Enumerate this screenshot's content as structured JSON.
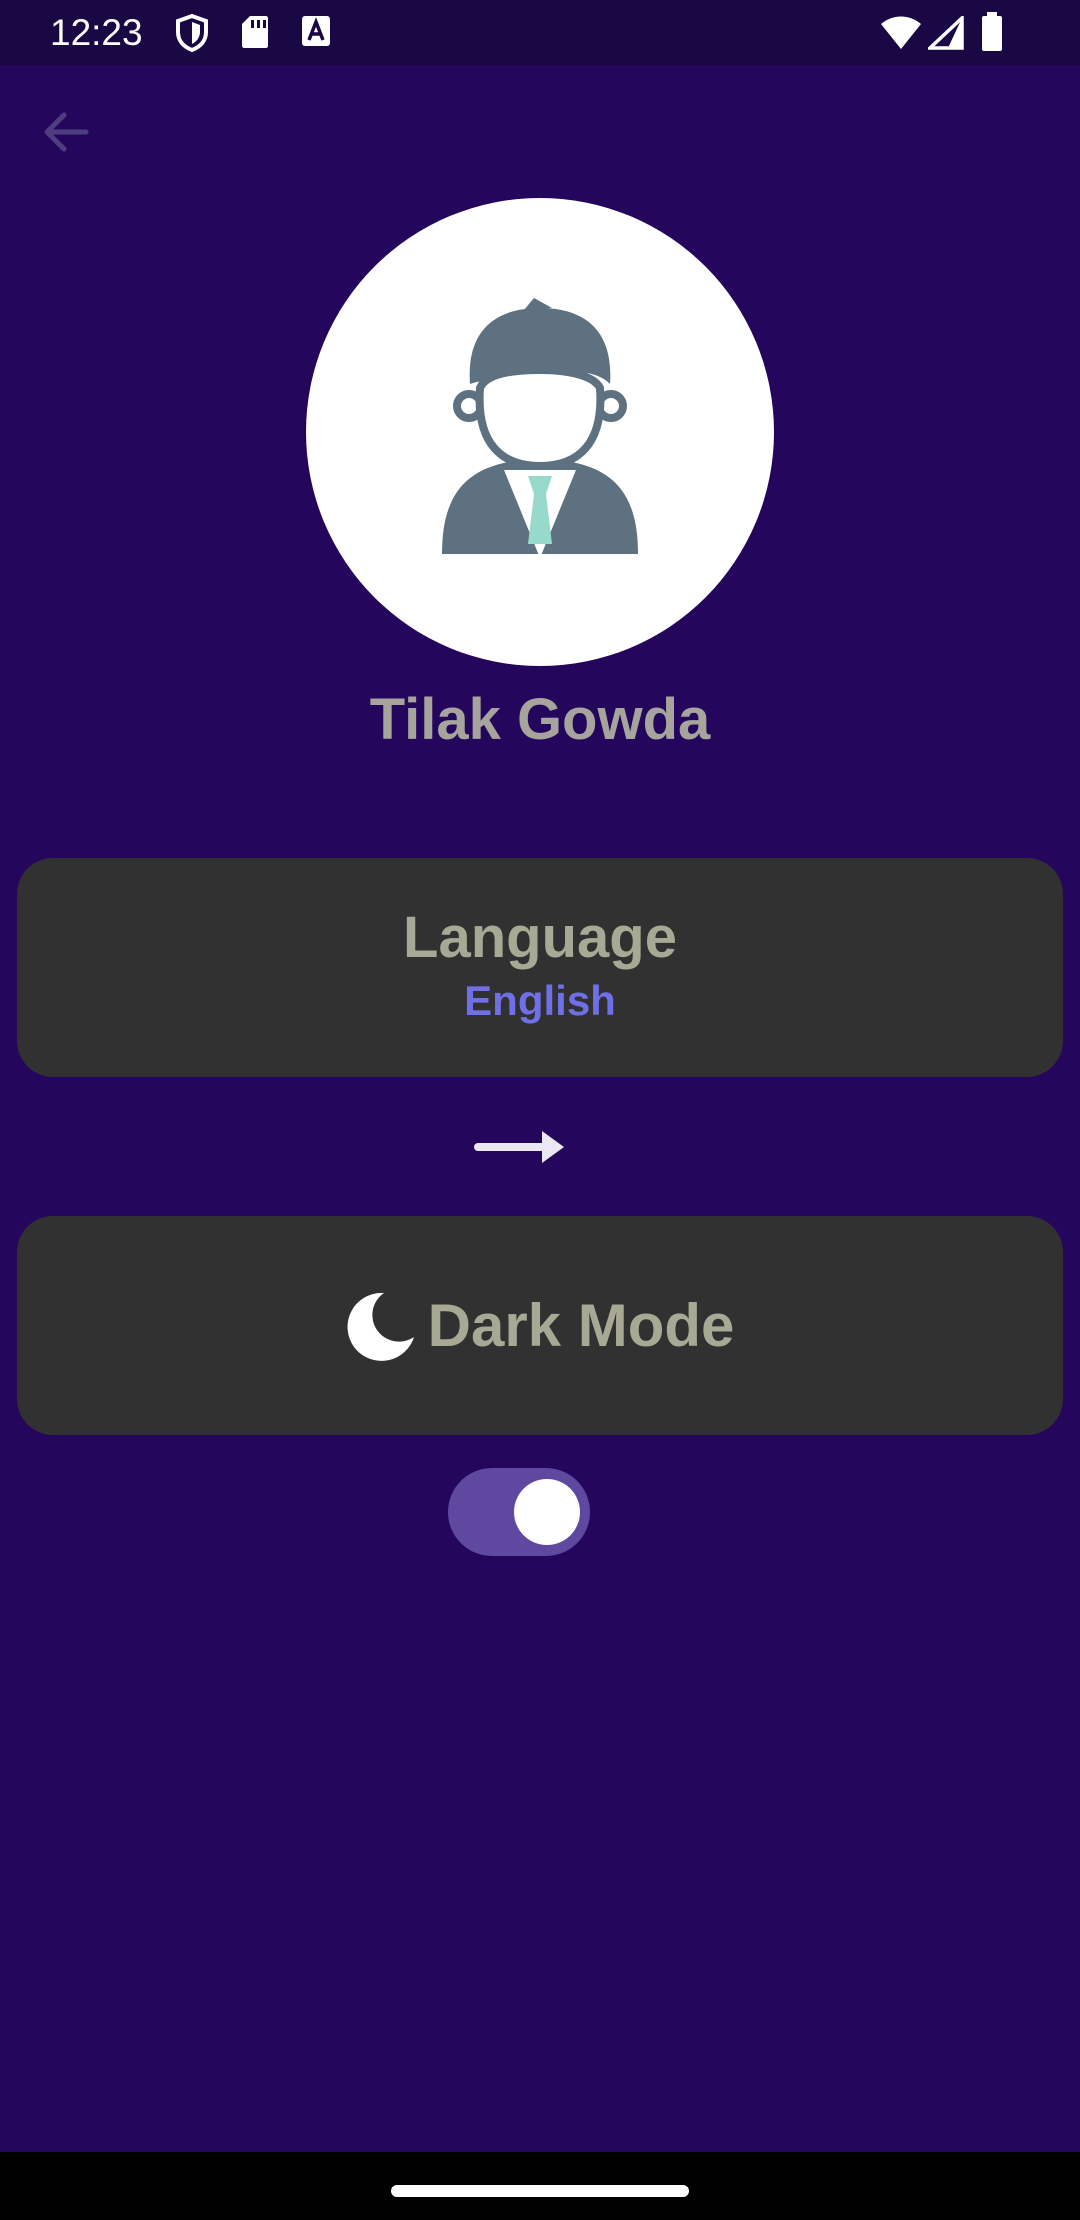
{
  "status_bar": {
    "time": "12:23",
    "icons": [
      "shield-icon",
      "sd-card-icon",
      "font-a-icon",
      "wifi-icon",
      "cell-signal-icon",
      "battery-icon"
    ]
  },
  "header": {
    "back_icon": "arrow-back-icon"
  },
  "profile": {
    "name": "Tilak Gowda",
    "avatar_icon": "user-avatar-icon"
  },
  "language": {
    "title": "Language",
    "value": "English"
  },
  "next_icon": "arrow-right-icon",
  "dark_mode": {
    "label": "Dark Mode",
    "icon": "moon-icon",
    "enabled": true
  },
  "colors": {
    "background": "#24065d",
    "card": "#313131",
    "accent": "#6f70e6",
    "toggle_track": "#5f48a0",
    "text": "#a8a994"
  }
}
